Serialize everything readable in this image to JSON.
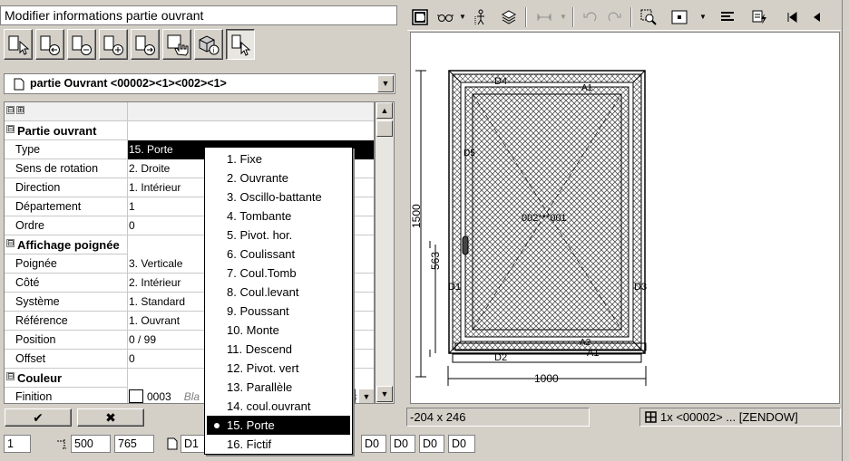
{
  "left_panel": {
    "title": "Modifier informations partie ouvrant",
    "toolbar_icons": [
      "select-part-icon",
      "part-prev-icon",
      "part-remove-icon",
      "part-add-icon",
      "part-next-icon",
      "pan-hand-icon",
      "info-3d-icon",
      "part-pointer-icon"
    ],
    "part_selector": "partie Ouvrant <00002><1><002><1>",
    "grid": {
      "expand_glyphs": [
        "⊟",
        "⊞"
      ],
      "rows": [
        {
          "kind": "category",
          "name": "Partie ouvrant",
          "value": ""
        },
        {
          "kind": "prop",
          "name": "Type",
          "value": "15. Porte",
          "selected": true
        },
        {
          "kind": "prop",
          "name": "Sens de rotation",
          "value": "2. Droite"
        },
        {
          "kind": "prop",
          "name": "Direction",
          "value": "1. Intérieur"
        },
        {
          "kind": "prop",
          "name": "Département",
          "value": "1"
        },
        {
          "kind": "prop",
          "name": "Ordre",
          "value": "0"
        },
        {
          "kind": "category",
          "name": "Affichage poignée",
          "value": ""
        },
        {
          "kind": "prop",
          "name": "Poignée",
          "value": "3. Verticale"
        },
        {
          "kind": "prop",
          "name": "Côté",
          "value": "2. Intérieur"
        },
        {
          "kind": "prop",
          "name": "Système",
          "value": "1. Standard"
        },
        {
          "kind": "prop",
          "name": "Référence",
          "value": "1. Ouvrant"
        },
        {
          "kind": "prop",
          "name": "Position",
          "value": "0 / 99"
        },
        {
          "kind": "prop",
          "name": "Offset",
          "value": "0"
        },
        {
          "kind": "category",
          "name": "Couleur",
          "value": ""
        },
        {
          "kind": "prop",
          "name": "Finition",
          "value": "0003",
          "value_extra": "Bla",
          "value_tail": "s",
          "has_swatch": true
        }
      ]
    },
    "ok_glyph": "✔",
    "cancel_glyph": "✖"
  },
  "type_dropdown": {
    "options": [
      "1. Fixe",
      "2. Ouvrante",
      "3. Oscillo-battante",
      "4. Tombante",
      "5. Pivot. hor.",
      "6. Coulissant",
      "7. Coul.Tomb",
      "8. Coul.levant",
      "9. Poussant",
      "10. Monte",
      "11. Descend",
      "12. Pivot. vert",
      "13. Parallèle",
      "14. coul.ouvrant",
      "15. Porte",
      "16. Fictif"
    ],
    "selected_index": 14
  },
  "bottom_bar": {
    "field1": "1",
    "dim_x": "500",
    "dim_y": "765",
    "code_main": "D1",
    "codes": [
      "D0",
      "D0",
      "D0",
      "D0"
    ]
  },
  "right_panel": {
    "toolbar_icons": [
      "view-mode-icon",
      "glasses-icon",
      "person-icon",
      "layers-icon",
      "dimension-icon",
      "undo-icon",
      "redo-icon",
      "zoom-select-icon",
      "frame-icon",
      "align-icon",
      "check-lightning-icon",
      "first-icon",
      "prev-icon"
    ],
    "drawing": {
      "height_label": "1500",
      "handle_label": "563",
      "width_label": "1000",
      "center_label": "002***001",
      "labels": [
        "D4",
        "D2",
        "D1",
        "D3",
        "A1",
        "D5",
        "A1",
        "A2"
      ]
    },
    "status_dimensions": "-204 x 246",
    "status_selection": "1x <00002> ... [ZENDOW]"
  }
}
